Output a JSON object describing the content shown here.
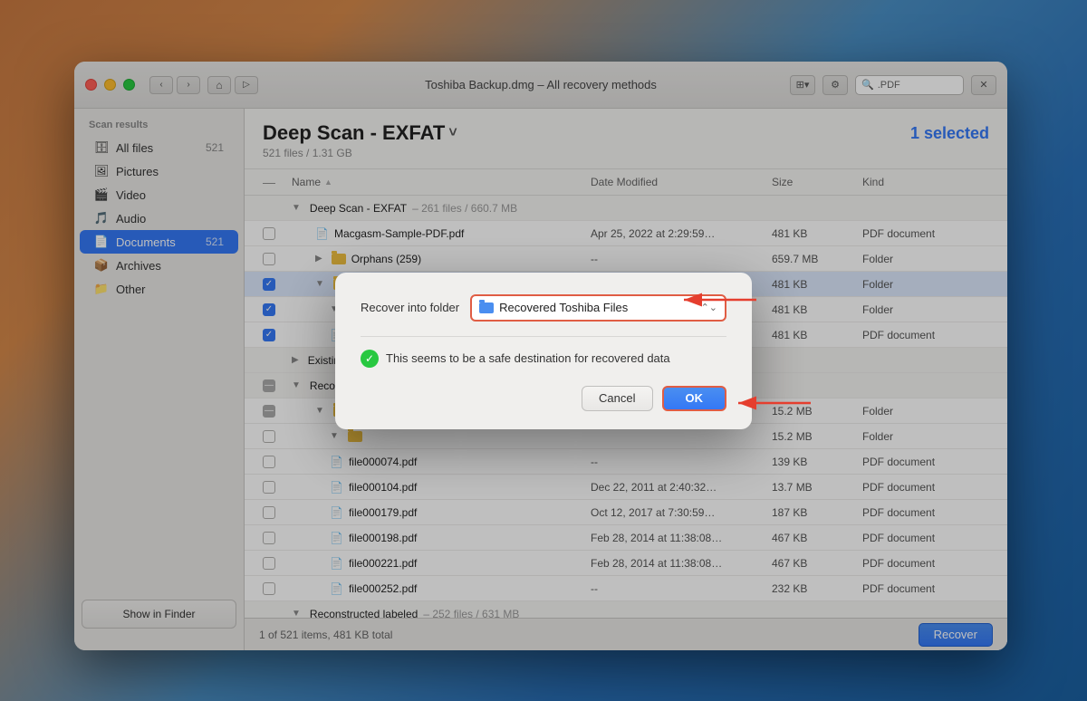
{
  "background": {
    "color": "#4a7fa5"
  },
  "window": {
    "title": "Toshiba Backup.dmg – All recovery methods",
    "traffic_lights": {
      "red_label": "close",
      "yellow_label": "minimize",
      "green_label": "maximize"
    }
  },
  "titlebar": {
    "title": "Toshiba Backup.dmg – All recovery methods",
    "nav": {
      "back": "‹",
      "forward": "›"
    },
    "search_placeholder": ".PDF"
  },
  "sidebar": {
    "section_title": "Scan results",
    "items": [
      {
        "id": "all-files",
        "label": "All files",
        "count": "521",
        "icon": "🗄"
      },
      {
        "id": "pictures",
        "label": "Pictures",
        "count": "",
        "icon": "🖼"
      },
      {
        "id": "video",
        "label": "Video",
        "count": "",
        "icon": "🎬"
      },
      {
        "id": "audio",
        "label": "Audio",
        "count": "",
        "icon": "🎵"
      },
      {
        "id": "documents",
        "label": "Documents",
        "count": "521",
        "icon": "📄",
        "active": true
      },
      {
        "id": "archives",
        "label": "Archives",
        "count": "",
        "icon": "📦"
      },
      {
        "id": "other",
        "label": "Other",
        "count": "",
        "icon": "📁"
      }
    ],
    "footer_btn": "Show in Finder"
  },
  "content_header": {
    "scan_title": "Deep Scan - EXFAT",
    "chevron": "˅",
    "subtitle": "521 files / 1.31 GB",
    "selected_text": "1 selected"
  },
  "table": {
    "columns": [
      "",
      "Name",
      "Date Modified",
      "Size",
      "Kind"
    ],
    "groups": [
      {
        "id": "deep-scan-exfat",
        "label": "Deep Scan - EXFAT",
        "meta": "261 files / 660.7 MB",
        "expanded": true,
        "rows": [
          {
            "id": "r1",
            "check": "none",
            "name": "Macgasm-Sample-PDF.pdf",
            "date": "Apr 25, 2022 at 2:29:59…",
            "size": "481 KB",
            "kind": "PDF document",
            "icon": "pdf",
            "indent": 1
          },
          {
            "id": "r2",
            "check": "none",
            "name": "Orphans (259)",
            "date": "--",
            "size": "659.7 MB",
            "kind": "Folder",
            "icon": "folder",
            "indent": 1
          },
          {
            "id": "r3",
            "check": "checked",
            "name": "...",
            "date": "",
            "size": "481 KB",
            "kind": "Folder",
            "icon": "folder",
            "indent": 1
          },
          {
            "id": "r4",
            "check": "checked",
            "name": "...",
            "date": "",
            "size": "481 KB",
            "kind": "Folder",
            "icon": "folder",
            "indent": 1
          },
          {
            "id": "r5",
            "check": "checked",
            "name": "...",
            "date": "",
            "size": "481 KB",
            "kind": "PDF document",
            "icon": "pdf",
            "indent": 1
          }
        ]
      },
      {
        "id": "existing",
        "label": "Existing",
        "meta": "",
        "expanded": false,
        "rows": []
      },
      {
        "id": "reconstructed",
        "label": "Reconstructed",
        "meta": "",
        "expanded": true,
        "rows": [
          {
            "id": "r6",
            "check": "dash",
            "name": "...",
            "date": "",
            "size": "15.2 MB",
            "kind": "Folder",
            "icon": "folder",
            "indent": 1
          },
          {
            "id": "r7",
            "check": "none",
            "name": "...",
            "date": "",
            "size": "15.2 MB",
            "kind": "Folder",
            "icon": "folder",
            "indent": 1
          },
          {
            "id": "r8",
            "check": "none",
            "name": "file000074.pdf",
            "date": "--",
            "size": "139 KB",
            "kind": "PDF document",
            "icon": "pdf",
            "indent": 1
          },
          {
            "id": "r9",
            "check": "none",
            "name": "file000104.pdf",
            "date": "Dec 22, 2011 at 2:40:32…",
            "size": "13.7 MB",
            "kind": "PDF document",
            "icon": "pdf",
            "indent": 1
          },
          {
            "id": "r10",
            "check": "none",
            "name": "file000179.pdf",
            "date": "Oct 12, 2017 at 7:30:59…",
            "size": "187 KB",
            "kind": "PDF document",
            "icon": "pdf",
            "indent": 1
          },
          {
            "id": "r11",
            "check": "none",
            "name": "file000198.pdf",
            "date": "Feb 28, 2014 at 11:38:08…",
            "size": "467 KB",
            "kind": "PDF document",
            "icon": "pdf",
            "indent": 1
          },
          {
            "id": "r12",
            "check": "none",
            "name": "file000221.pdf",
            "date": "Feb 28, 2014 at 11:38:08…",
            "size": "467 KB",
            "kind": "PDF document",
            "icon": "pdf",
            "indent": 1
          },
          {
            "id": "r13",
            "check": "none",
            "name": "file000252.pdf",
            "date": "--",
            "size": "232 KB",
            "kind": "PDF document",
            "icon": "pdf",
            "indent": 1
          }
        ]
      },
      {
        "id": "reconstructed-labeled",
        "label": "Reconstructed labeled",
        "meta": "252 files / 631 MB",
        "expanded": false,
        "rows": []
      }
    ]
  },
  "status_bar": {
    "text": "1 of 521 items, 481 KB total",
    "recover_btn": "Recover"
  },
  "modal": {
    "label": "Recover into folder",
    "folder_name": "Recovered Toshiba Files",
    "status_text": "This seems to be a safe destination for recovered data",
    "cancel_btn": "Cancel",
    "ok_btn": "OK"
  }
}
